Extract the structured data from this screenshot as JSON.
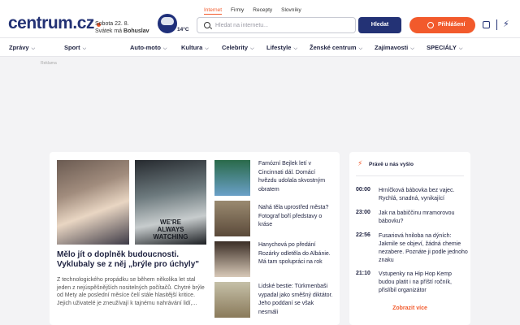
{
  "header": {
    "logo_text": "centrum",
    "logo_tld": ".cz",
    "date_line": "Sobota 22. 8.",
    "nameday_prefix": "Svátek má",
    "nameday_name": "Bohuslav",
    "temperature": "14°C",
    "search_tabs": [
      "Internet",
      "Firmy",
      "Recepty",
      "Slovníky"
    ],
    "search_placeholder": "Hledat na internetu...",
    "search_button": "Hledat",
    "login_button": "Přihlášení"
  },
  "nav": {
    "items": [
      "Zprávy",
      "Sport",
      "Auto-moto",
      "Kultura",
      "Celebrity",
      "Lifestyle",
      "Ženské centrum",
      "Zajímavosti",
      "SPECIÁLY"
    ]
  },
  "ad_label": "Reklama",
  "main": {
    "lead_image_text": "WE'RE ALWAYS WATCHING",
    "lead_headline": "Mělo jít o doplněk budoucnosti. Vyklubaly se z něj „brýle pro úchyly\"",
    "lead_perex": "Z technologického propádku se během několika let stal jeden z nejúspěšnějších nositelných počítačů. Chytré brýle od Mety ale poslední měsíce čelí stále hlasitější kritice. Jejich uživatelé je zneužívají k tajnému nahrávání lidí,...",
    "side_stories": [
      "Famózní Bejlek letí v Cincinnati dál. Domácí hvězdu udolala skvostným obratem",
      "Nahá těla uprostřed města? Fotograf boří představy o kráse",
      "Hanychová po předání Rozárky odletěla do Albánie. Má tam spolupráci na rok",
      "Lidské bestie: Türkmenbaši vypadal jako směšný diktátor. Jeho poddaní se však nesmáli"
    ]
  },
  "sidebar": {
    "title": "Právě u nás vyšlo",
    "items": [
      {
        "time": "00:00",
        "text": "Hrníčková bábovka bez vajec. Rychlá, snadná, vynikající"
      },
      {
        "time": "23:00",
        "text": "Jak na babiččinu mramorovou bábovku?"
      },
      {
        "time": "22:56",
        "text": "Fusariová hniloba na dýních: Jakmile se objeví, žádná chemie nezabere. Poznáte ji podle jednoho znaku"
      },
      {
        "time": "21:10",
        "text": "Vstupenky na Hip Hop Kemp budou platit i na příští ročník, přislíbil organizátor"
      }
    ],
    "more_label": "Zobrazit více"
  }
}
